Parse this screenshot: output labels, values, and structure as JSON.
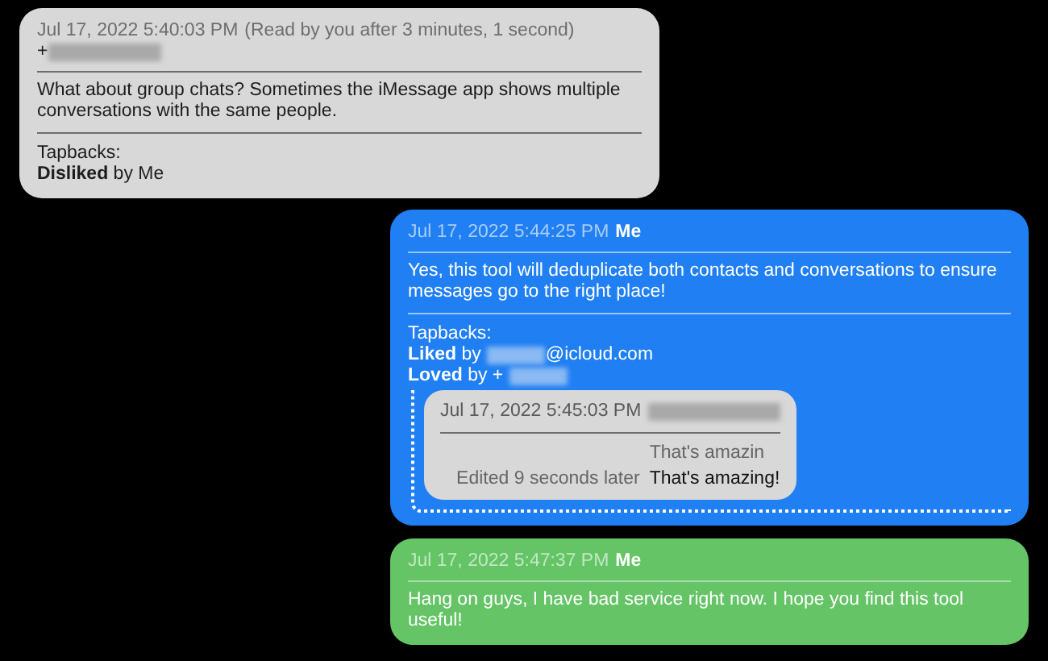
{
  "messages": [
    {
      "kind": "received",
      "timestamp": "Jul 17, 2022 5:40:03 PM",
      "read_note": "(Read by you after 3 minutes, 1 second)",
      "sender": "+",
      "sender_redacted": true,
      "body": "What about group chats? Sometimes the iMessage app shows multiple conversations with the same people.",
      "tapbacks_label": "Tapbacks:",
      "tapbacks": [
        {
          "text": "**Disliked** by Me"
        }
      ]
    },
    {
      "kind": "imessage",
      "timestamp": "Jul 17, 2022 5:44:25 PM",
      "sender": "Me",
      "sender_redacted": false,
      "body": "Yes, this tool will deduplicate both contacts and conversations to ensure messages go to the right place!",
      "tapbacks_label": "Tapbacks:",
      "tapbacks": [
        {
          "text": "**Liked** by",
          "redacted": true,
          "suffix": "@icloud.com"
        },
        {
          "text": "**Loved** by +",
          "redacted": true
        }
      ],
      "reply": {
        "timestamp": "Jul 17, 2022 5:45:03 PM",
        "sender_redacted": true,
        "edits": [
          {
            "text": "That's amazin",
            "current": false
          },
          {
            "note": "Edited 9 seconds later",
            "text": "That's amazing!",
            "current": true
          }
        ]
      }
    },
    {
      "kind": "sms",
      "timestamp": "Jul 17, 2022 5:47:37 PM",
      "sender": "Me",
      "sender_redacted": false,
      "body": "Hang on guys, I have bad service right now. I hope you find this tool useful!"
    }
  ]
}
